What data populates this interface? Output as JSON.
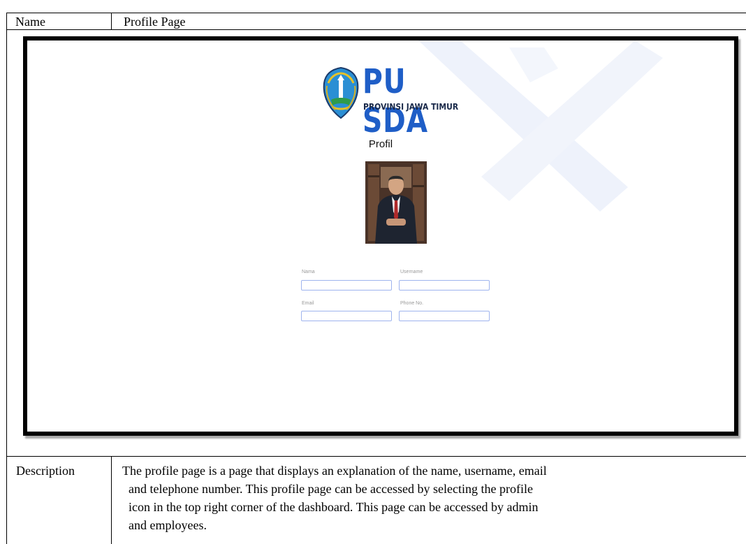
{
  "document": {
    "name_label": "Name",
    "name_value": "Profile Page",
    "description_label": "Description",
    "description_text": "The profile page is a page that displays an explanation of the name, username, email\n  and telephone number. This profile page can be accessed by selecting the profile\n  icon in the top right corner of the dashboard. This page can be accessed by admin\n  and employees."
  },
  "screen": {
    "logo": {
      "title": "PU SDA",
      "subtitle": "PROVINSI JAWA TIMUR",
      "emblem_icon": "east-java-coat-of-arms-icon"
    },
    "page_title": "Profil",
    "profile_photo": "profile-photo",
    "form": {
      "nama_label": "Nama",
      "nama_value": "",
      "username_label": "Username",
      "username_value": "",
      "email_label": "Email",
      "email_value": "",
      "phone_label": "Phone No.",
      "phone_value": ""
    }
  },
  "colors": {
    "brand_blue": "#1f5ec7",
    "input_border": "#9fb4ee",
    "watermark": "#eef2fb"
  }
}
